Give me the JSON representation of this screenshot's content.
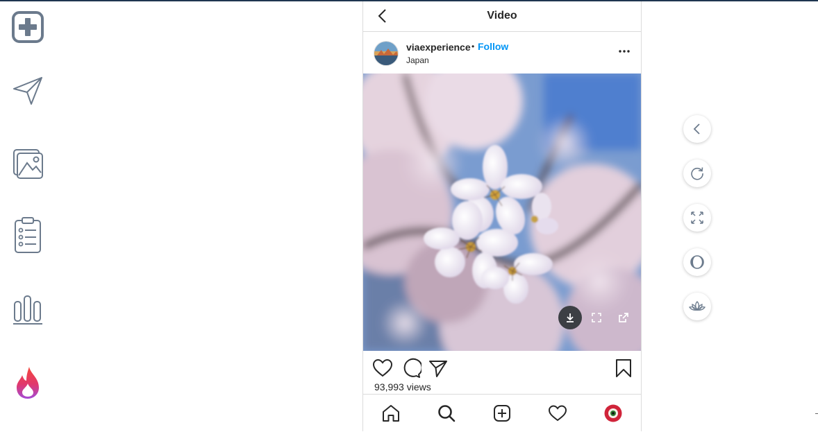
{
  "header": {
    "title": "Video"
  },
  "post": {
    "username": "viaexperience",
    "separator": "•",
    "follow_label": "Follow",
    "location": "Japan",
    "views": "93,993 views"
  },
  "colors": {
    "accent": "#0095f6",
    "icon_gray": "#6b7a8c",
    "text": "#262626",
    "flame_top": "#f5473a",
    "flame_bottom": "#a34bd6"
  },
  "left_sidebar": [
    "plus-square-icon",
    "send-icon",
    "images-icon",
    "checklist-icon",
    "bar-chart-icon",
    "flame-logo-icon"
  ],
  "media_controls": [
    "download-icon",
    "fullscreen-icon",
    "external-link-icon"
  ],
  "post_actions": [
    "heart-icon",
    "comment-icon",
    "share-icon",
    "bookmark-icon"
  ],
  "bottom_nav": [
    "home-icon",
    "search-icon",
    "new-post-icon",
    "activity-heart-icon",
    "profile-avatar"
  ],
  "right_tools": [
    "chevron-left-icon",
    "refresh-icon",
    "expand-icon",
    "dark-mode-icon",
    "lotus-icon"
  ]
}
